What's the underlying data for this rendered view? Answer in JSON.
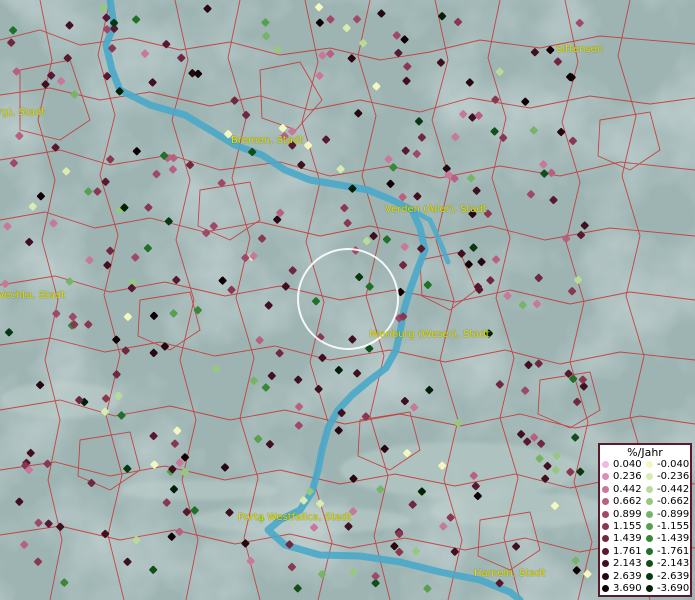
{
  "cities": [
    {
      "name": "Sittensen"
    },
    {
      "name": "rg), Stadt"
    },
    {
      "name": "Bremen, Stadt"
    },
    {
      "name": "Verden (Aller), Stadt"
    },
    {
      "name": "Vechta, Stadt"
    },
    {
      "name": "Nienburg (Weser), Stadt"
    },
    {
      "name": "Porta Westfalica, Stadt"
    },
    {
      "name": "Hameln, Stadt"
    }
  ],
  "legend": {
    "title": "%/Jahr",
    "positive": [
      {
        "label": "0.040",
        "color": "#f0b8e0"
      },
      {
        "label": "0.236",
        "color": "#d890b8"
      },
      {
        "label": "0.442",
        "color": "#c87898"
      },
      {
        "label": "0.662",
        "color": "#b86080"
      },
      {
        "label": "0.899",
        "color": "#a04868"
      },
      {
        "label": "1.155",
        "color": "#883850"
      },
      {
        "label": "1.439",
        "color": "#702840"
      },
      {
        "label": "1.761",
        "color": "#581830"
      },
      {
        "label": "2.143",
        "color": "#401020"
      },
      {
        "label": "2.639",
        "color": "#280810"
      },
      {
        "label": "3.690",
        "color": "#100004"
      }
    ],
    "negative": [
      {
        "label": "-0.040",
        "color": "#f4f8c0"
      },
      {
        "label": "-0.236",
        "color": "#d8ecb0"
      },
      {
        "label": "-0.442",
        "color": "#b8dc98"
      },
      {
        "label": "-0.662",
        "color": "#98c880"
      },
      {
        "label": "-0.899",
        "color": "#78b468"
      },
      {
        "label": "-1.155",
        "color": "#58a050"
      },
      {
        "label": "-1.439",
        "color": "#388838"
      },
      {
        "label": "-1.761",
        "color": "#207028"
      },
      {
        "label": "-2.143",
        "color": "#105018"
      },
      {
        "label": "-2.639",
        "color": "#083810"
      },
      {
        "label": "-3.690",
        "color": "#002008"
      }
    ]
  },
  "colors": {
    "river": "#4aa8c8",
    "borders": "#c83030",
    "terrain": "#8fa8a8",
    "label": "#e8e000",
    "selection_ring": "#ffffff"
  }
}
